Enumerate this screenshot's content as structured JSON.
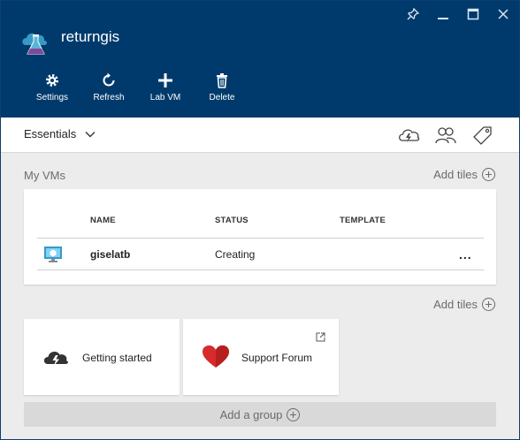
{
  "header": {
    "title": "returngis",
    "background": "#003a6c",
    "window_controls": [
      "pin-icon",
      "minimize-icon",
      "maximize-icon",
      "close-icon"
    ],
    "toolbar": [
      {
        "label": "Settings",
        "icon": "gear-icon"
      },
      {
        "label": "Refresh",
        "icon": "refresh-icon"
      },
      {
        "label": "Lab VM",
        "icon": "plus-icon"
      },
      {
        "label": "Delete",
        "icon": "trash-icon"
      }
    ]
  },
  "essentials": {
    "label": "Essentials",
    "icons": [
      "cloud-lightning-icon",
      "users-icon",
      "tag-icon"
    ]
  },
  "my_vms": {
    "title": "My VMs",
    "add_tiles": "Add tiles",
    "columns": [
      "NAME",
      "STATUS",
      "TEMPLATE"
    ],
    "rows": [
      {
        "icon": "vm-monitor-icon",
        "name": "giselatb",
        "status": "Creating",
        "template": "",
        "more": "..."
      }
    ]
  },
  "tiles_section": {
    "add_tiles": "Add tiles",
    "tiles": [
      {
        "label": "Getting started",
        "icon": "cloud-lightning-icon"
      },
      {
        "label": "Support Forum",
        "icon": "heart-icon",
        "external": true
      }
    ]
  },
  "add_group": {
    "label": "Add a group"
  }
}
